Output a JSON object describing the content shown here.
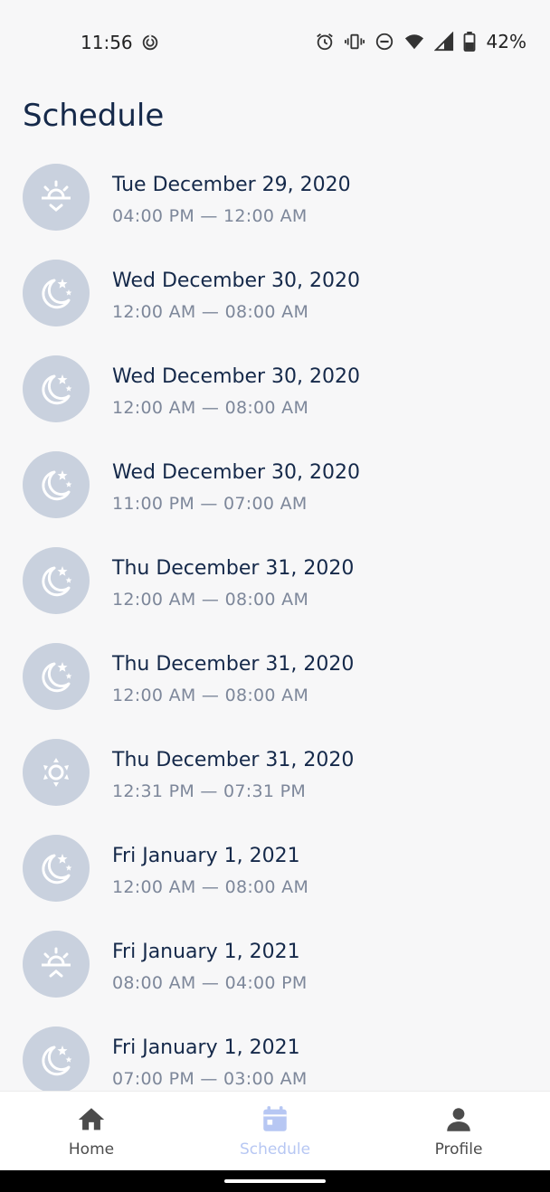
{
  "status_bar": {
    "time": "11:56",
    "battery_percent": "42%",
    "icons": [
      "radar-icon",
      "alarm-icon",
      "vibrate-icon",
      "do-not-disturb-icon",
      "wifi-icon",
      "signal-icon",
      "battery-icon"
    ]
  },
  "page": {
    "title": "Schedule"
  },
  "schedule": [
    {
      "icon": "sunset-icon",
      "date": "Tue December 29, 2020",
      "time": "04:00 PM — 12:00 AM"
    },
    {
      "icon": "moon-stars-icon",
      "date": "Wed December 30, 2020",
      "time": "12:00 AM — 08:00 AM"
    },
    {
      "icon": "moon-stars-icon",
      "date": "Wed December 30, 2020",
      "time": "12:00 AM — 08:00 AM"
    },
    {
      "icon": "moon-stars-icon",
      "date": "Wed December 30, 2020",
      "time": "11:00 PM — 07:00 AM"
    },
    {
      "icon": "moon-stars-icon",
      "date": "Thu December 31, 2020",
      "time": "12:00 AM — 08:00 AM"
    },
    {
      "icon": "moon-stars-icon",
      "date": "Thu December 31, 2020",
      "time": "12:00 AM — 08:00 AM"
    },
    {
      "icon": "sun-icon",
      "date": "Thu December 31, 2020",
      "time": "12:31 PM — 07:31 PM"
    },
    {
      "icon": "moon-stars-icon",
      "date": "Fri January 1, 2021",
      "time": "12:00 AM — 08:00 AM"
    },
    {
      "icon": "sunrise-icon",
      "date": "Fri January 1, 2021",
      "time": "08:00 AM — 04:00 PM"
    },
    {
      "icon": "moon-stars-icon",
      "date": "Fri January 1, 2021",
      "time": "07:00 PM — 03:00 AM"
    }
  ],
  "bottom_nav": {
    "active": "schedule",
    "active_color": "#b7c7f3",
    "inactive_color": "#4c4c4c",
    "items": [
      {
        "label": "Home",
        "icon": "home-icon"
      },
      {
        "label": "Schedule",
        "icon": "calendar-icon"
      },
      {
        "label": "Profile",
        "icon": "person-icon"
      }
    ]
  }
}
